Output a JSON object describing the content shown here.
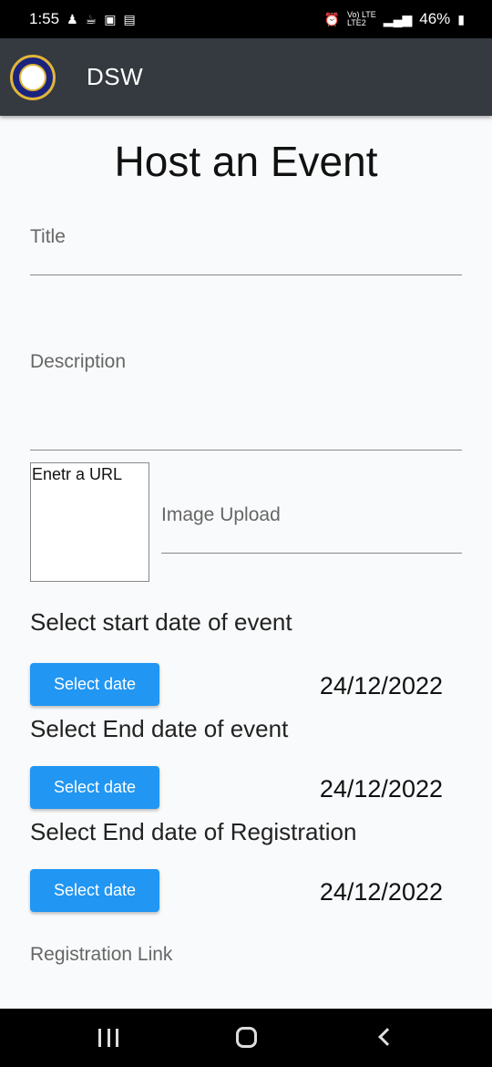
{
  "status_bar": {
    "time": "1:55",
    "network": "Vo) LTE",
    "network_sub": "LTE2",
    "battery": "46%"
  },
  "app_bar": {
    "logo_icon": "university-seal-icon",
    "title": "DSW"
  },
  "form": {
    "heading": "Host an Event",
    "title_label": "Title",
    "description_label": "Description",
    "url_placeholder": "Enetr a URL",
    "image_upload_label": "Image Upload",
    "start_date": {
      "label": "Select start date of event",
      "button": "Select date",
      "value": "24/12/2022"
    },
    "end_date": {
      "label": "Select End date of event",
      "button": "Select date",
      "value": "24/12/2022"
    },
    "reg_end_date": {
      "label": "Select End date of Registration",
      "button": "Select date",
      "value": "24/12/2022"
    },
    "registration_link_label": "Registration Link"
  },
  "colors": {
    "app_bar": "#343a40",
    "button": "#2196f3",
    "background": "#f9fafb"
  }
}
